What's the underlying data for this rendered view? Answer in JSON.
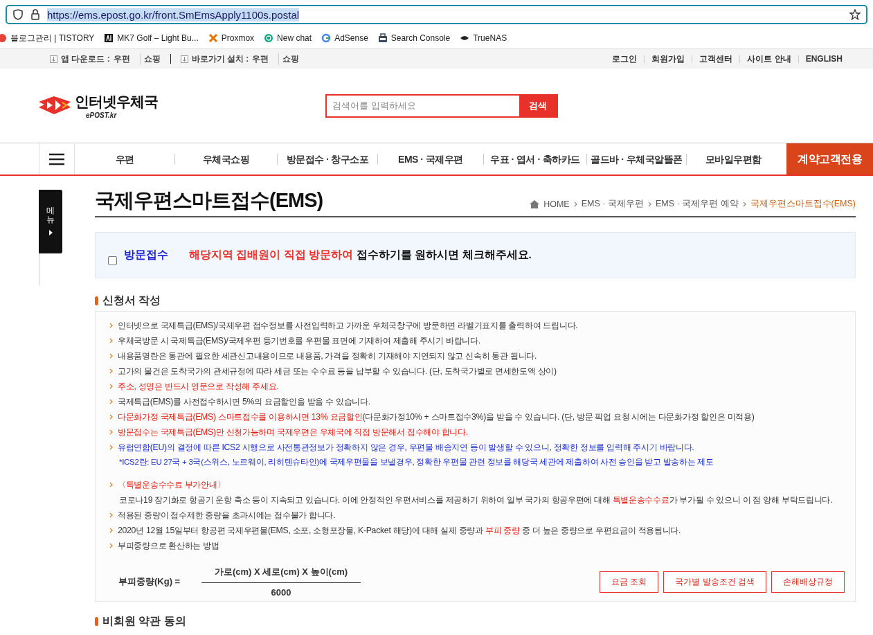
{
  "browser": {
    "url": "https://ems.epost.go.kr/front.SmEmsApply1100s.postal",
    "bookmarks": [
      {
        "label": "블로그관리 | TISTORY"
      },
      {
        "label": "MK7 Golf – Light Bu..."
      },
      {
        "label": "Proxmox"
      },
      {
        "label": "New chat"
      },
      {
        "label": "AdSense"
      },
      {
        "label": "Search Console"
      },
      {
        "label": "TrueNAS"
      }
    ]
  },
  "topbar": {
    "groups": [
      {
        "label": "앱 다운로드 :",
        "links": [
          "우편",
          "쇼핑"
        ]
      },
      {
        "label": "바로가기 설치 :",
        "links": [
          "우편",
          "쇼핑"
        ]
      }
    ],
    "links": [
      "로그인",
      "회원가입",
      "고객센터",
      "사이트 안내",
      "ENGLISH"
    ]
  },
  "header": {
    "logo_text": "인터넷우체국",
    "logo_sub": "ePOST.kr",
    "search": {
      "placeholder": "검색어를 입력하세요",
      "button": "검색"
    }
  },
  "nav": [
    {
      "label": "우편",
      "kind": "normal"
    },
    {
      "label": "우체국쇼핑",
      "kind": "normal"
    },
    {
      "label": "방문접수 · 창구소포",
      "kind": "normal"
    },
    {
      "label": "EMS · 국제우편",
      "kind": "normal"
    },
    {
      "label": "우표 · 엽서 · 축하카드",
      "kind": "normal"
    },
    {
      "label": "골드바 · 우체국알뜰폰",
      "kind": "normal"
    },
    {
      "label": "모바일우편함",
      "kind": "normal"
    },
    {
      "label": "계약고객전용",
      "kind": "special"
    }
  ],
  "side_tab": {
    "label": "메뉴"
  },
  "page_title": "국제우편스마트접수(EMS)",
  "breadcrumb": [
    "HOME",
    "EMS · 국제우편",
    "EMS · 국제우편 예약",
    "국제우편스마트접수(EMS)"
  ],
  "visit_pickup": {
    "checked": false,
    "label": "방문접수",
    "notice_red": "해당지역 집배원이 직접 방문하여",
    "notice": "접수하기를 원하시면 체크해주세요."
  },
  "section_title": "신청서 작성",
  "notices": [
    {
      "kind": "bullet",
      "parts": [
        {
          "text": "인터넷으로 국제특급(EMS)/국제우편 접수정보를 사전입력하고 가까운 우체국창구에 방문하면 라벨기표지를 출력하여 드립니다.",
          "kind": "plain"
        }
      ]
    },
    {
      "kind": "bullet",
      "parts": [
        {
          "text": "우체국방문 시 국제특급(EMS)/국제우편 등기번호를 우편물 표면에 기재하여 제출해 주시기 바랍니다.",
          "kind": "plain"
        }
      ]
    },
    {
      "kind": "bullet",
      "parts": [
        {
          "text": "내용품명란은 통관에 필요한 세관신고내용이므로 내용품, 가격을 정확히 기재해야 지연되지 않고 신속히 통관 됩니다.",
          "kind": "plain"
        }
      ]
    },
    {
      "kind": "bullet",
      "parts": [
        {
          "text": "고가의 물건은 도착국가의 관세규정에 따라 세금 또는 수수료 등을 납부할 수 있습니다. (단, 도착국가별로 면세한도액 상이)",
          "kind": "plain"
        }
      ]
    },
    {
      "kind": "bullet",
      "parts": [
        {
          "text": "주소, 성명은 반드시 영문으로 작성해 주세요.",
          "kind": "warning"
        }
      ]
    },
    {
      "kind": "bullet",
      "parts": [
        {
          "text": "국제특급(EMS)를 사전접수하시면 5%의 요금할인을 받을 수 있습니다.",
          "kind": "plain"
        }
      ]
    },
    {
      "kind": "bullet",
      "parts": [
        {
          "text": "다문화가정 국제특급(EMS) 스마트접수를 이용하시면 13% 요금할인",
          "kind": "warning"
        },
        {
          "text": "(다문화가정10% + 스마트접수3%)을 받을 수 있습니다.  (단, 방문 픽업 요청 시에는 다문화가정 할인은 미적용)",
          "kind": "plain"
        }
      ]
    },
    {
      "kind": "bullet",
      "parts": [
        {
          "text": "방문접수는 국제특급(EMS)만 신청가능하며 국제우편은 우체국에 직접 방문해서 접수해야 합니다.",
          "kind": "warning"
        }
      ]
    },
    {
      "kind": "bullet",
      "parts": [
        {
          "text": "유럽연합(EU)의 결정에 따른 ICS2 시행으로 사전통관정보가 정확하지 않은 경우, 우편물 배송지연 등이 발생할 수 있으니, 정확한 정보를 입력해 주시기 바랍니다.",
          "kind": "info"
        }
      ]
    },
    {
      "kind": "note",
      "parts": [
        {
          "text": "*ICS2란: EU 27국 + 3국(스위스, 노르웨이, 리히텐슈타인)에 국제우편물을 보낼경우, 정확한 우편물 관련 정보를 해당국 세관에 제출하여 사전 승인을 받고 발송하는 제도",
          "kind": "info"
        }
      ]
    },
    {
      "kind": "heading",
      "parts": [
        {
          "text": "〈특별운송수수료 부가안내〉",
          "kind": "warning"
        }
      ]
    },
    {
      "kind": "note",
      "parts": [
        {
          "text": "코로나19 장기화로 항공기 운항 축소 등이 지속되고 있습니다. 이에 안정적인 우편서비스를 제공하기 위하여 일부 국가의 항공우편에 대해 ",
          "kind": "plain"
        },
        {
          "text": "특별운송수수료",
          "kind": "warning"
        },
        {
          "text": "가 부가될 수 있으니 이 점 양해 부탁드립니다.",
          "kind": "plain"
        }
      ]
    },
    {
      "kind": "bullet",
      "parts": [
        {
          "text": "적용된 중량이 접수제한 중량을 초과시에는 접수불가 합니다.",
          "kind": "plain"
        }
      ]
    },
    {
      "kind": "bullet",
      "parts": [
        {
          "text": "2020년 12월 15일부터 항공편 국제우편물(EMS, 소포, 소형포장물, K-Packet 해당)에 대해 실제 중량과 ",
          "kind": "plain"
        },
        {
          "text": "부피 중량",
          "kind": "warning"
        },
        {
          "text": " 중 더 높은 중량으로 우편요금이 적용됩니다.",
          "kind": "plain"
        }
      ]
    },
    {
      "kind": "bullet",
      "parts": [
        {
          "text": "부피중량으로 환산하는 방법",
          "kind": "plain"
        }
      ]
    }
  ],
  "formula": {
    "label": "부피중량(Kg) =",
    "numerator": "가로(cm) X 세로(cm) X 높이(cm)",
    "denominator": "6000"
  },
  "buttons": [
    "요금 조회",
    "국가별 발송조건 검색",
    "손해배상규정"
  ],
  "next_section_title": "비회원 약관 동의"
}
